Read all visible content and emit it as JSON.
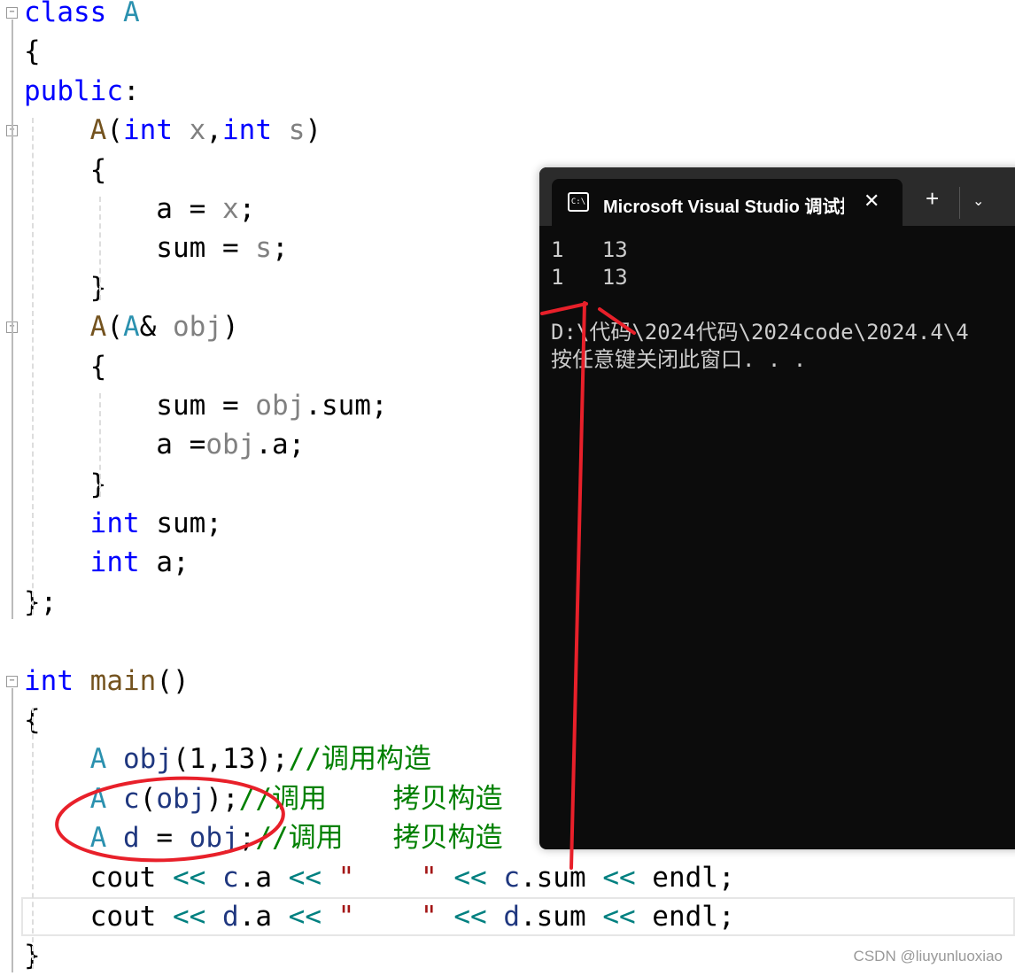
{
  "editor": {
    "lines": [
      [
        [
          "class",
          "kw"
        ],
        [
          " "
        ],
        [
          "A",
          "cls"
        ]
      ],
      [
        [
          "{"
        ]
      ],
      [
        [
          "public",
          "kw"
        ],
        [
          ":"
        ]
      ],
      [
        [
          "    "
        ],
        [
          "A",
          "fn"
        ],
        [
          "("
        ],
        [
          "int",
          "kw"
        ],
        [
          " "
        ],
        [
          "x",
          "par"
        ],
        [
          ","
        ],
        [
          "int",
          "kw"
        ],
        [
          " "
        ],
        [
          "s",
          "par"
        ],
        [
          ")"
        ]
      ],
      [
        [
          "    {"
        ]
      ],
      [
        [
          "        a = "
        ],
        [
          "x",
          "par"
        ],
        [
          ";"
        ]
      ],
      [
        [
          "        sum = "
        ],
        [
          "s",
          "par"
        ],
        [
          ";"
        ]
      ],
      [
        [
          "    }"
        ]
      ],
      [
        [
          "    "
        ],
        [
          "A",
          "fn"
        ],
        [
          "("
        ],
        [
          "A",
          "cls"
        ],
        [
          "& "
        ],
        [
          "obj",
          "par"
        ],
        [
          ")"
        ]
      ],
      [
        [
          "    {"
        ]
      ],
      [
        [
          "        sum = "
        ],
        [
          "obj",
          "par"
        ],
        [
          ".sum;"
        ]
      ],
      [
        [
          "        a ="
        ],
        [
          "obj",
          "par"
        ],
        [
          ".a;"
        ]
      ],
      [
        [
          "    }"
        ]
      ],
      [
        [
          "    "
        ],
        [
          "int",
          "kw"
        ],
        [
          " sum;"
        ]
      ],
      [
        [
          "    "
        ],
        [
          "int",
          "kw"
        ],
        [
          " a;"
        ]
      ],
      [
        [
          "};"
        ]
      ],
      [
        [
          ""
        ]
      ],
      [
        [
          "int",
          "kw"
        ],
        [
          " "
        ],
        [
          "main",
          "fn"
        ],
        [
          "()"
        ]
      ],
      [
        [
          "{"
        ]
      ],
      [
        [
          "    "
        ],
        [
          "A",
          "cls"
        ],
        [
          " "
        ],
        [
          "obj",
          "var"
        ],
        [
          "(1,13);"
        ],
        [
          "//调用构造",
          "cm"
        ]
      ],
      [
        [
          "    "
        ],
        [
          "A",
          "cls"
        ],
        [
          " "
        ],
        [
          "c",
          "var"
        ],
        [
          "("
        ],
        [
          "obj",
          "var"
        ],
        [
          ");"
        ],
        [
          "//调用    拷贝构造",
          "cm"
        ]
      ],
      [
        [
          "    "
        ],
        [
          "A",
          "cls"
        ],
        [
          " "
        ],
        [
          "d",
          "var"
        ],
        [
          " = "
        ],
        [
          "obj",
          "var"
        ],
        [
          ";"
        ],
        [
          "//调用   拷贝构造",
          "cm"
        ]
      ],
      [
        [
          "    cout "
        ],
        [
          "<<",
          "op"
        ],
        [
          " "
        ],
        [
          "c",
          "var"
        ],
        [
          ".a "
        ],
        [
          "<<",
          "op"
        ],
        [
          " "
        ],
        [
          "\"    \"",
          "str"
        ],
        [
          " "
        ],
        [
          "<<",
          "op"
        ],
        [
          " "
        ],
        [
          "c",
          "var"
        ],
        [
          ".sum "
        ],
        [
          "<<",
          "op"
        ],
        [
          " endl;"
        ]
      ],
      [
        [
          "    cout "
        ],
        [
          "<<",
          "op"
        ],
        [
          " "
        ],
        [
          "d",
          "var"
        ],
        [
          ".a "
        ],
        [
          "<<",
          "op"
        ],
        [
          " "
        ],
        [
          "\"    \"",
          "str"
        ],
        [
          " "
        ],
        [
          "<<",
          "op"
        ],
        [
          " "
        ],
        [
          "d",
          "var"
        ],
        [
          ".sum "
        ],
        [
          "<<",
          "op"
        ],
        [
          " endl;"
        ]
      ],
      [
        [
          "}"
        ]
      ]
    ],
    "current_line": 23,
    "fold_lines": [
      0,
      3,
      8,
      17
    ]
  },
  "terminal": {
    "tab_icon": "console-icon",
    "tab_icon_text": "C:\\",
    "tab_title": "Microsoft Visual Studio 调试控制台",
    "close_label": "✕",
    "new_tab_label": "+",
    "dropdown_label": "⌄",
    "output": "1   13\n1   13\n\nD:\\代码\\2024代码\\2024code\\2024.4\\4\n按任意键关闭此窗口. . ."
  },
  "annotation_color": "#e8202a",
  "watermark": "CSDN @liuyunluoxiao"
}
